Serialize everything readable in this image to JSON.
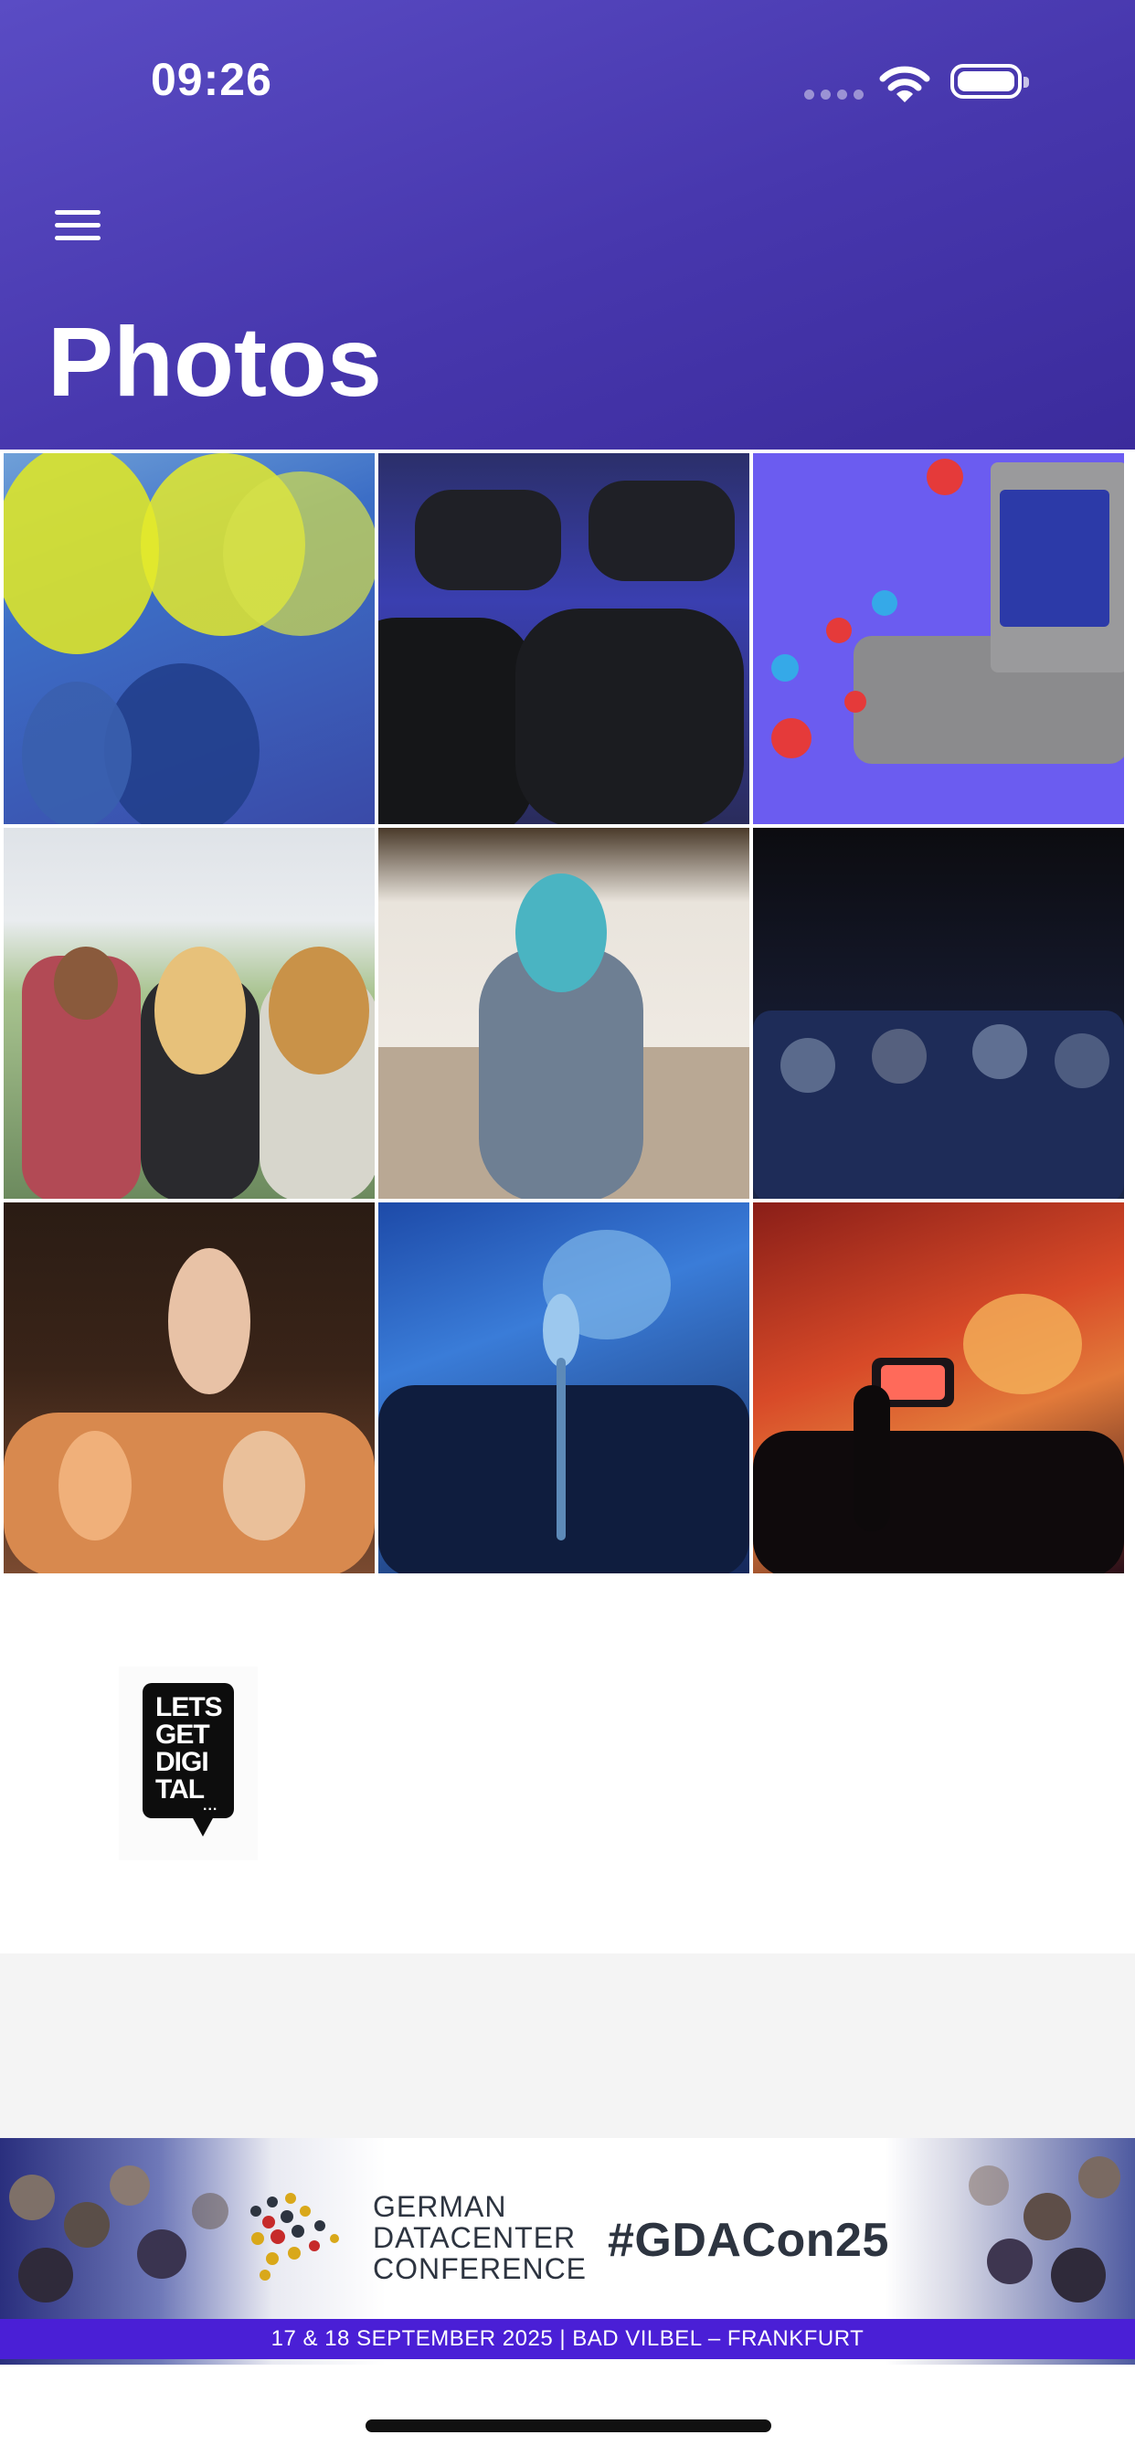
{
  "status_bar": {
    "time": "09:26"
  },
  "header": {
    "title": "Photos",
    "menu_icon": "hamburger-menu-icon"
  },
  "photos": [
    {
      "name": "photo-color-festival"
    },
    {
      "name": "photo-conference-chairs"
    },
    {
      "name": "photo-social-stage"
    },
    {
      "name": "photo-festival-crowd"
    },
    {
      "name": "photo-audience-speaker"
    },
    {
      "name": "photo-dark-audience"
    },
    {
      "name": "photo-concert-hands"
    },
    {
      "name": "photo-microphone-stage"
    },
    {
      "name": "photo-phone-concert"
    }
  ],
  "logo": {
    "lines": [
      "LETS",
      "GET",
      "DIGI",
      "TAL"
    ],
    "dots": "..."
  },
  "banner": {
    "name_lines": [
      "GERMAN",
      "DATACENTER",
      "CONFERENCE"
    ],
    "hashtag": "#GDACon25",
    "date_location": "17 & 18 SEPTEMBER 2025 | BAD VILBEL – FRANKFURT",
    "accent_color": "#4a1fd6"
  },
  "colors": {
    "header_start": "#5a4cc4",
    "header_end": "#3b2b9c"
  }
}
